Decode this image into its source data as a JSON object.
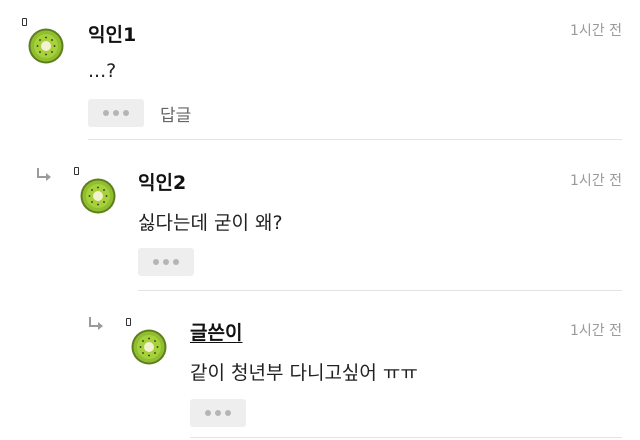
{
  "comments": [
    {
      "author": "익인1",
      "time": "1시간 전",
      "text": "...?",
      "reply_label": "답글",
      "avatar_icon": "kiwi-avatar-icon"
    },
    {
      "author": "익인2",
      "time": "1시간 전",
      "text": "싫다는데 굳이 왜?",
      "avatar_icon": "kiwi-avatar-icon"
    },
    {
      "author": "글쓴이",
      "time": "1시간 전",
      "text": "같이 청년부 다니고싶어 ㅠㅠ",
      "avatar_icon": "kiwi-avatar-icon"
    }
  ],
  "colors": {
    "kiwi_skin": "#6b8e23",
    "kiwi_flesh": "#9acd32",
    "kiwi_center": "#f5f5dc",
    "divider": "#e3e3e3",
    "time_text": "#9a9a9a"
  }
}
